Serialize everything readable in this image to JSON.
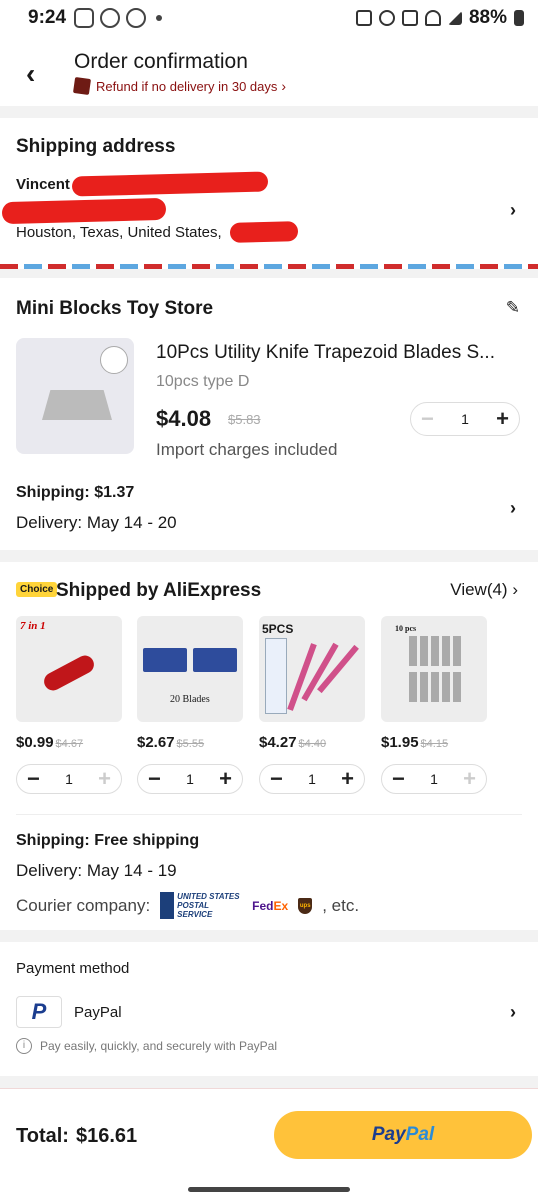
{
  "status_bar": {
    "time": "9:24",
    "battery": "88%"
  },
  "header": {
    "title": "Order confirmation",
    "refund": "Refund if no delivery in 30 days"
  },
  "shipping_address": {
    "title": "Shipping address",
    "name": "Vincent",
    "address": "Houston, Texas, United States,"
  },
  "store": {
    "name": "Mini Blocks Toy Store",
    "product": {
      "title": "10Pcs Utility Knife Trapezoid Blades S...",
      "variant": "10pcs type D",
      "price": "$4.08",
      "old_price": "$5.83",
      "import_note": "Import charges included",
      "qty": "1"
    },
    "shipping": "Shipping: $1.37",
    "delivery": "Delivery: May 14 - 20"
  },
  "choice": {
    "badge": "Choice",
    "title": "Shipped by AliExpress",
    "view_all": "View(4)",
    "items": [
      {
        "thumb_text": "7 in 1",
        "price": "$0.99",
        "old": "$4.67",
        "qty": "1"
      },
      {
        "thumb_text": "20 Blades",
        "price": "$2.67",
        "old": "$5.55",
        "qty": "1"
      },
      {
        "thumb_text": "5PCS",
        "price": "$4.27",
        "old": "$4.40",
        "qty": "1"
      },
      {
        "thumb_text": "10 pcs",
        "price": "$1.95",
        "old": "$4.15",
        "qty": "1"
      }
    ],
    "shipping": "Shipping: Free shipping",
    "delivery": "Delivery: May 14 - 19",
    "courier_label": "Courier company:",
    "courier_usps": "UNITED STATES POSTAL SERVICE",
    "courier_fedex_a": "Fed",
    "courier_fedex_b": "Ex",
    "courier_ups": "ups",
    "courier_etc": ", etc."
  },
  "payment": {
    "title": "Payment method",
    "icon_letter": "P",
    "method": "PayPal",
    "note": "Pay easily, quickly, and securely with PayPal"
  },
  "footer": {
    "total_label": "Total:",
    "total_value": "$16.61",
    "pay_button_a": "Pay",
    "pay_button_b": "Pal"
  }
}
